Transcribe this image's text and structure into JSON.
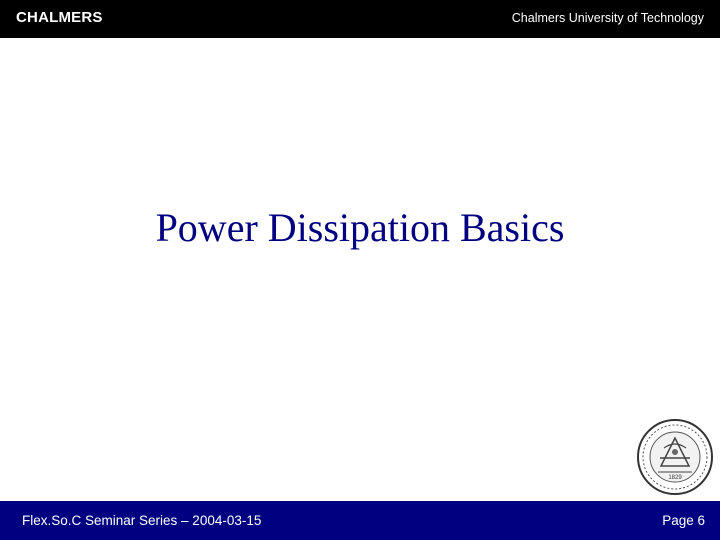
{
  "header": {
    "logo_text": "CHALMERS",
    "institution": "Chalmers University of Technology"
  },
  "slide": {
    "title": "Power Dissipation Basics"
  },
  "footer": {
    "series": "Flex.So.C Seminar Series – 2004-03-15",
    "page": "Page 6"
  },
  "seal": {
    "icon": "university-seal-icon",
    "year_text": "1829"
  },
  "colors": {
    "header_bg": "#000000",
    "footer_bg": "#000080",
    "title_color": "#000080",
    "header_text": "#ffffff"
  }
}
